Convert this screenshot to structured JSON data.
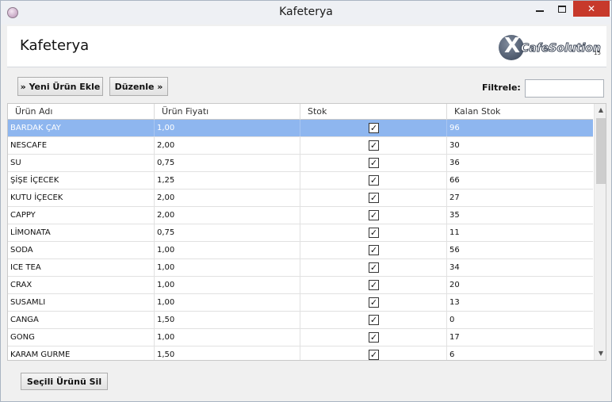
{
  "window": {
    "title": "Kafeterya"
  },
  "header": {
    "title": "Kafeterya",
    "logo_mark": "X",
    "logo_text": "CafeSolution",
    "logo_sub": "15"
  },
  "toolbar": {
    "add_label": "» Yeni Ürün Ekle",
    "edit_label": "Düzenle »",
    "filter_label": "Filtrele:",
    "filter_value": ""
  },
  "grid": {
    "columns": [
      "Ürün Adı",
      "Ürün Fiyatı",
      "Stok",
      "Kalan Stok"
    ],
    "selected_row": 0,
    "rows": [
      {
        "name": "BARDAK ÇAY",
        "price": "1,00",
        "stock": true,
        "remaining": "96"
      },
      {
        "name": "NESCAFE",
        "price": "2,00",
        "stock": true,
        "remaining": "30"
      },
      {
        "name": "SU",
        "price": "0,75",
        "stock": true,
        "remaining": "36"
      },
      {
        "name": "ŞİŞE İÇECEK",
        "price": "1,25",
        "stock": true,
        "remaining": "66"
      },
      {
        "name": "KUTU İÇECEK",
        "price": "2,00",
        "stock": true,
        "remaining": "27"
      },
      {
        "name": "CAPPY",
        "price": "2,00",
        "stock": true,
        "remaining": "35"
      },
      {
        "name": "LİMONATA",
        "price": "0,75",
        "stock": true,
        "remaining": "11"
      },
      {
        "name": "SODA",
        "price": "1,00",
        "stock": true,
        "remaining": "56"
      },
      {
        "name": "ICE TEA",
        "price": "1,00",
        "stock": true,
        "remaining": "34"
      },
      {
        "name": "CRAX",
        "price": "1,00",
        "stock": true,
        "remaining": "20"
      },
      {
        "name": "SUSAMLI",
        "price": "1,00",
        "stock": true,
        "remaining": "13"
      },
      {
        "name": "CANGA",
        "price": "1,50",
        "stock": true,
        "remaining": "0"
      },
      {
        "name": "GONG",
        "price": "1,00",
        "stock": true,
        "remaining": "17"
      },
      {
        "name": "KARAM GURME",
        "price": "1,50",
        "stock": true,
        "remaining": "6"
      }
    ]
  },
  "footer": {
    "delete_label": "Seçili Ürünü Sil"
  },
  "colors": {
    "selection": "#8eb6ef",
    "close_button": "#c7392b"
  },
  "icons": {
    "app": "app-orb-icon",
    "check": "checkmark-icon",
    "scroll_up": "chevron-up-icon",
    "scroll_down": "chevron-down-icon"
  }
}
